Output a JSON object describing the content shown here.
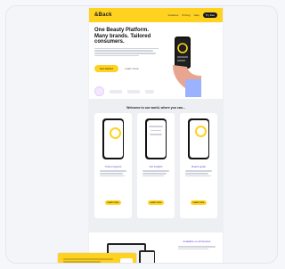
{
  "nav": {
    "logo": "&Back",
    "links": [
      "Features",
      "Pricing",
      "Help"
    ],
    "cta": "Try free"
  },
  "hero": {
    "headline": "One Beauty Platform. Many brands. Tailored consumers.",
    "primary_cta": "Get started",
    "secondary_cta": "Learn more"
  },
  "section": {
    "title": "Welcome to our world, where you can...",
    "columns": [
      {
        "title": "Track progress",
        "button": "Learn more"
      },
      {
        "title": "Get insights",
        "button": "Learn more"
      },
      {
        "title": "Reach goals",
        "button": "Learn more"
      }
    ]
  },
  "lower": {
    "title": "Available on all devices"
  },
  "colors": {
    "brand": "#ffd21f",
    "accent": "#5a3fd1",
    "dark": "#111111"
  }
}
